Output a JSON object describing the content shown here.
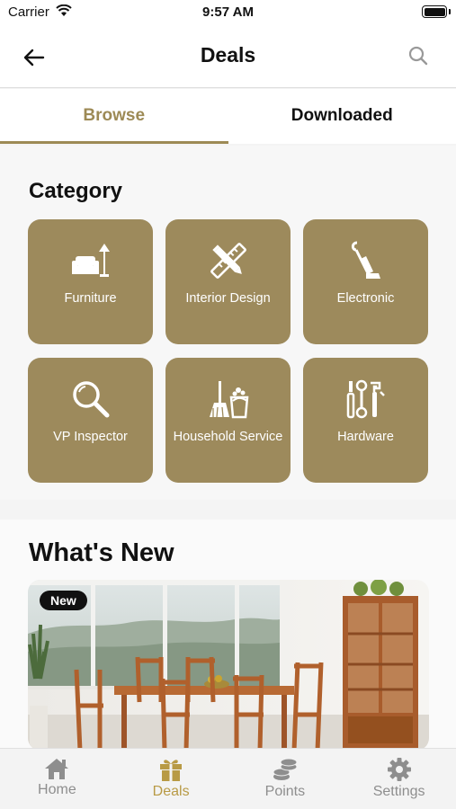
{
  "status_bar": {
    "carrier": "Carrier",
    "time": "9:57 AM"
  },
  "nav": {
    "title": "Deals"
  },
  "tabs": [
    {
      "label": "Browse",
      "active": true
    },
    {
      "label": "Downloaded",
      "active": false
    }
  ],
  "category": {
    "title": "Category",
    "items": [
      {
        "label": "Furniture",
        "icon": "sofa-lamp-icon"
      },
      {
        "label": "Interior Design",
        "icon": "pencil-ruler-icon"
      },
      {
        "label": "Electronic",
        "icon": "vacuum-icon"
      },
      {
        "label": "VP Inspector",
        "icon": "magnifier-icon"
      },
      {
        "label": "Household Service",
        "icon": "broom-bucket-icon"
      },
      {
        "label": "Hardware",
        "icon": "tools-icon"
      }
    ]
  },
  "whats_new": {
    "title": "What's New",
    "badge": "New"
  },
  "tab_bar": [
    {
      "label": "Home",
      "icon": "home-icon",
      "active": false
    },
    {
      "label": "Deals",
      "icon": "gift-icon",
      "active": true
    },
    {
      "label": "Points",
      "icon": "coins-icon",
      "active": false
    },
    {
      "label": "Settings",
      "icon": "gear-icon",
      "active": false
    }
  ],
  "colors": {
    "accent": "#9d8a5c",
    "tab_active": "#b89a45"
  }
}
